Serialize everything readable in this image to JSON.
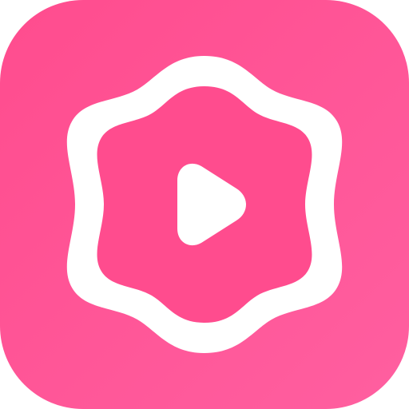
{
  "icon": {
    "name": "app-icon-play-flower",
    "background_gradient": [
      "#ff4c8e",
      "#ff5fa0"
    ],
    "ring_color": "#ffffff",
    "inner_fill_color": "#ff4c8e",
    "play_color": "#ffffff"
  }
}
